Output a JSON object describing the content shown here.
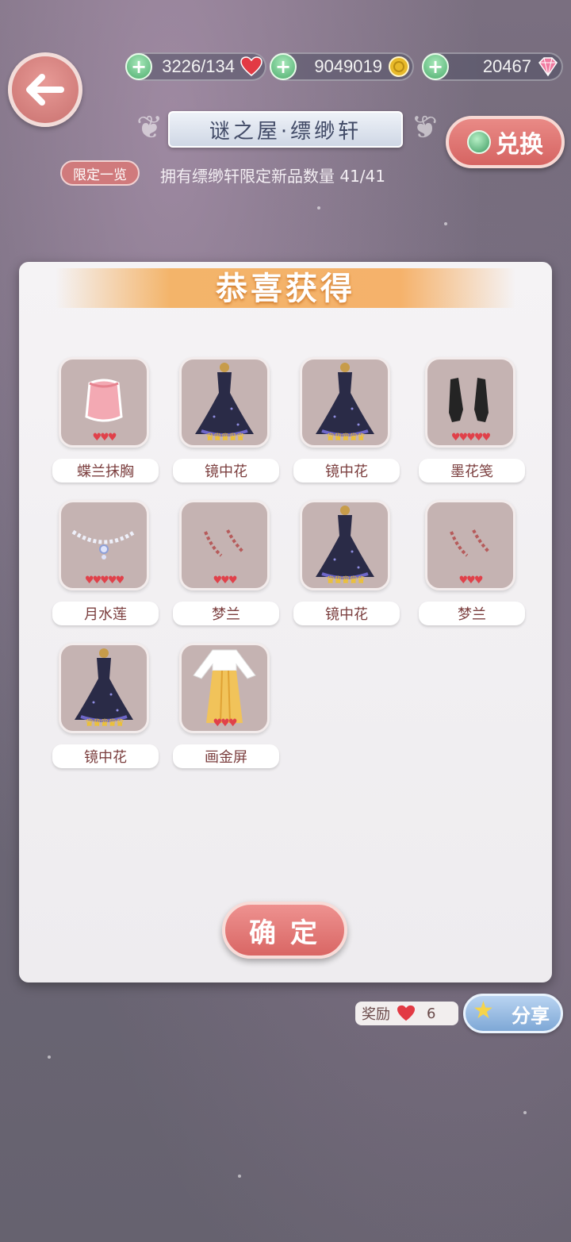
{
  "header": {
    "hearts_value": "3226/134",
    "coins_value": "9049019",
    "diamonds_value": "20467",
    "title": "谜之屋·缥缈轩",
    "exchange_label": "兑换",
    "limited_tag": "限定一览",
    "owned_text": "拥有缥缈轩限定新品数量 41/41"
  },
  "dialog": {
    "title": "恭喜获得",
    "items": [
      {
        "name": "蝶兰抹胸",
        "rating": "♥♥♥",
        "type": "heart",
        "icon": "pink-top-icon"
      },
      {
        "name": "镜中花",
        "rating": "♛♛♛♛♛",
        "type": "crown",
        "icon": "black-dress-icon"
      },
      {
        "name": "镜中花",
        "rating": "♛♛♛♛♛",
        "type": "crown",
        "icon": "black-dress-icon"
      },
      {
        "name": "墨花笺",
        "rating": "♥♥♥♥♥",
        "type": "heart",
        "icon": "black-gloves-icon"
      },
      {
        "name": "月水莲",
        "rating": "♥♥♥♥♥",
        "type": "heart",
        "icon": "necklace-icon"
      },
      {
        "name": "梦兰",
        "rating": "♥♥♥",
        "type": "heart",
        "icon": "bracelet-icon"
      },
      {
        "name": "镜中花",
        "rating": "♛♛♛♛♛",
        "type": "crown",
        "icon": "black-dress-icon"
      },
      {
        "name": "梦兰",
        "rating": "♥♥♥",
        "type": "heart",
        "icon": "bracelet-icon"
      },
      {
        "name": "镜中花",
        "rating": "♛♛♛♛♛",
        "type": "crown",
        "icon": "black-dress-icon"
      },
      {
        "name": "画金屏",
        "rating": "♥♥♥",
        "type": "heart",
        "icon": "yellow-hanfu-icon"
      }
    ],
    "confirm_label": "确定"
  },
  "footer": {
    "reward_label": "奖励",
    "reward_count": "6",
    "share_label": "分享"
  },
  "colors": {
    "accent_red": "#d66462",
    "heart": "#e0414a",
    "crown": "#f3c323",
    "banner": "#f3b46a"
  }
}
